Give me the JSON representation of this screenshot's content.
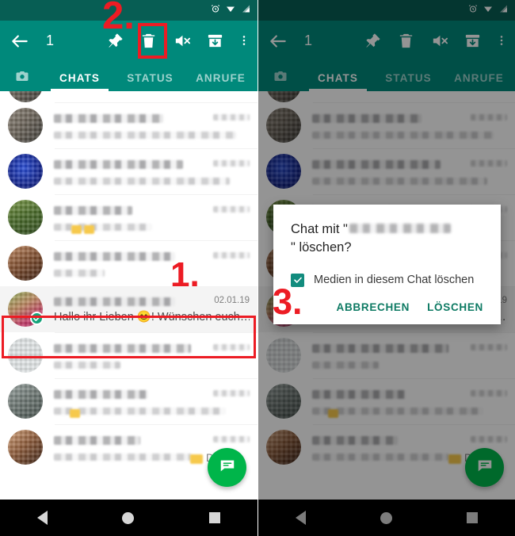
{
  "meta": {
    "app": "WhatsApp",
    "language": "de",
    "accent_teal": "#00897b",
    "statusbar_teal": "#075e54",
    "annotation_red": "#ec1c24",
    "fab_green": "#00b54a",
    "dialog_action_color": "#0d7a63"
  },
  "statusbar": {
    "icons": [
      "alarm-icon",
      "wifi-icon",
      "signal-icon"
    ]
  },
  "appbar": {
    "back_icon": "back-arrow-icon",
    "selection_count": "1",
    "actions": [
      {
        "icon": "pin-icon",
        "name": "pin-chat-button"
      },
      {
        "icon": "trash-icon",
        "name": "delete-chat-button"
      },
      {
        "icon": "mute-icon",
        "name": "mute-chat-button"
      },
      {
        "icon": "archive-icon",
        "name": "archive-chat-button"
      },
      {
        "icon": "overflow-menu-icon",
        "name": "overflow-menu-button"
      }
    ]
  },
  "tabs": [
    {
      "label": "",
      "icon": "camera-icon",
      "name": "tab-camera",
      "active": false
    },
    {
      "label": "CHATS",
      "name": "tab-chats",
      "active": true
    },
    {
      "label": "STATUS",
      "name": "tab-status",
      "active": false
    },
    {
      "label": "ANRUFE",
      "name": "tab-anrufe",
      "active": false
    }
  ],
  "chat_list": {
    "rows": [
      {
        "avatar": "av-a",
        "title_blurred": true,
        "subtitle_blurred": true,
        "time_blurred": true,
        "partial": true
      },
      {
        "avatar": "av-a",
        "title_blurred": true,
        "subtitle_blurred": true,
        "time_blurred": true
      },
      {
        "avatar": "av-b",
        "title_blurred": true,
        "subtitle_blurred": true,
        "time_blurred": true
      },
      {
        "avatar": "av-c",
        "title_blurred": true,
        "subtitle_blurred": true,
        "time_blurred": true,
        "emoji": true
      },
      {
        "avatar": "av-d",
        "title_blurred": true,
        "subtitle_blurred": true,
        "time_blurred": true
      },
      {
        "avatar": "av-sel",
        "selected": true,
        "title_blurred": true,
        "time": "02.01.19",
        "message": "Hallo ihr Lieben 😊! Wünschen euch…",
        "badge": "check-icon"
      },
      {
        "avatar": "av-f",
        "title_blurred": true,
        "subtitle_blurred": true,
        "time_blurred": true
      },
      {
        "avatar": "av-g",
        "title_blurred": true,
        "subtitle_blurred": true,
        "time_blurred": true,
        "emoji": true
      },
      {
        "avatar": "av-h",
        "title_blurred": true,
        "subtitle_blurred": true,
        "time_blurred": true,
        "message_tail": "Danke!",
        "emoji": true
      }
    ]
  },
  "fab": {
    "icon": "new-chat-icon",
    "name": "new-chat-fab"
  },
  "navbar": {
    "back": "nav-back-icon",
    "home": "nav-home-icon",
    "recents": "nav-recents-icon"
  },
  "dialog": {
    "title_prefix": "Chat mit \"",
    "title_suffix": "\" löschen?",
    "checkbox_label": "Medien in diesem Chat löschen",
    "checkbox_checked": true,
    "cancel_label": "ABBRECHEN",
    "confirm_label": "LÖSCHEN"
  },
  "annotations": {
    "step1": "1.",
    "step2": "2.",
    "step3": "3."
  }
}
